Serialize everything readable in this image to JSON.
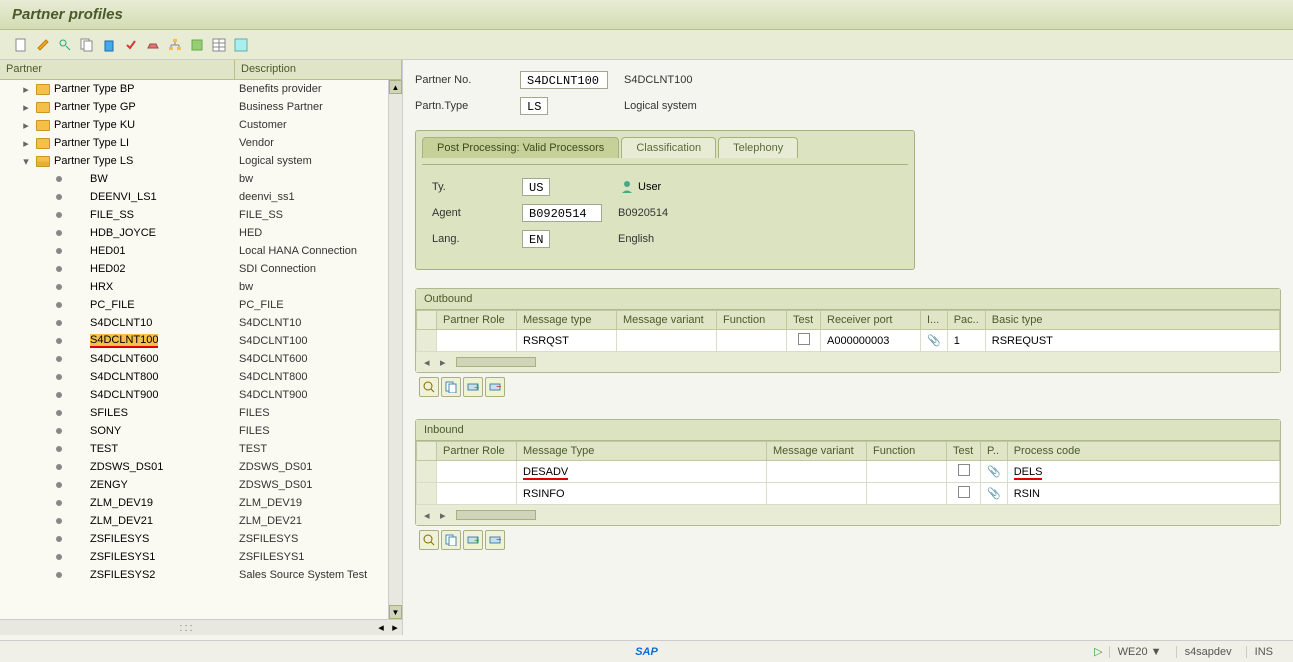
{
  "header": {
    "title": "Partner profiles"
  },
  "tree": {
    "col_partner": "Partner",
    "col_desc": "Description",
    "types": [
      {
        "label": "Partner Type BP",
        "desc": "Benefits provider",
        "expanded": false
      },
      {
        "label": "Partner Type GP",
        "desc": "Business Partner",
        "expanded": false
      },
      {
        "label": "Partner Type KU",
        "desc": "Customer",
        "expanded": false
      },
      {
        "label": "Partner Type LI",
        "desc": "Vendor",
        "expanded": false
      },
      {
        "label": "Partner Type LS",
        "desc": "Logical system",
        "expanded": true
      }
    ],
    "ls_items": [
      {
        "name": "BW",
        "desc": "bw"
      },
      {
        "name": "DEENVI_LS1",
        "desc": "deenvi_ss1"
      },
      {
        "name": "FILE_SS",
        "desc": "FILE_SS"
      },
      {
        "name": "HDB_JOYCE",
        "desc": "HED"
      },
      {
        "name": "HED01",
        "desc": "Local HANA Connection"
      },
      {
        "name": "HED02",
        "desc": "SDI Connection"
      },
      {
        "name": "HRX",
        "desc": "bw"
      },
      {
        "name": "PC_FILE",
        "desc": "PC_FILE"
      },
      {
        "name": "S4DCLNT10",
        "desc": "S4DCLNT10"
      },
      {
        "name": "S4DCLNT100",
        "desc": "S4DCLNT100",
        "selected": true
      },
      {
        "name": "S4DCLNT600",
        "desc": "S4DCLNT600"
      },
      {
        "name": "S4DCLNT800",
        "desc": "S4DCLNT800"
      },
      {
        "name": "S4DCLNT900",
        "desc": "S4DCLNT900"
      },
      {
        "name": "SFILES",
        "desc": "FILES"
      },
      {
        "name": "SONY",
        "desc": "FILES"
      },
      {
        "name": "TEST",
        "desc": "TEST"
      },
      {
        "name": "ZDSWS_DS01",
        "desc": "ZDSWS_DS01"
      },
      {
        "name": "ZENGY",
        "desc": "ZDSWS_DS01"
      },
      {
        "name": "ZLM_DEV19",
        "desc": "ZLM_DEV19"
      },
      {
        "name": "ZLM_DEV21",
        "desc": "ZLM_DEV21"
      },
      {
        "name": "ZSFILESYS",
        "desc": "ZSFILESYS"
      },
      {
        "name": "ZSFILESYS1",
        "desc": "ZSFILESYS1"
      },
      {
        "name": "ZSFILESYS2",
        "desc": "Sales Source System Test"
      }
    ]
  },
  "detail": {
    "partner_no_label": "Partner No.",
    "partner_no_value": "S4DCLNT100",
    "partner_no_display": "S4DCLNT100",
    "partn_type_label": "Partn.Type",
    "partn_type_value": "LS",
    "partn_type_display": "Logical system"
  },
  "tabs": {
    "t1": "Post Processing: Valid Processors",
    "t2": "Classification",
    "t3": "Telephony",
    "ty_label": "Ty.",
    "ty_value": "US",
    "ty_display": "User",
    "agent_label": "Agent",
    "agent_value": "B0920514",
    "agent_display": "B0920514",
    "lang_label": "Lang.",
    "lang_value": "EN",
    "lang_display": "English"
  },
  "outbound": {
    "title": "Outbound",
    "cols": {
      "role": "Partner Role",
      "msgtype": "Message type",
      "variant": "Message variant",
      "func": "Function",
      "test": "Test",
      "port": "Receiver port",
      "i": "I...",
      "pac": "Pac..",
      "basic": "Basic type"
    },
    "rows": [
      {
        "role": "",
        "msgtype": "RSRQST",
        "variant": "",
        "func": "",
        "test": false,
        "port": "A000000003",
        "i": "📎",
        "pac": "1",
        "basic": "RSREQUST"
      }
    ]
  },
  "inbound": {
    "title": "Inbound",
    "cols": {
      "role": "Partner Role",
      "msgtype": "Message Type",
      "variant": "Message variant",
      "func": "Function",
      "test": "Test",
      "p": "P..",
      "proc": "Process code"
    },
    "rows": [
      {
        "role": "",
        "msgtype": "DESADV",
        "variant": "",
        "func": "",
        "test": false,
        "p": "📎",
        "proc": "DELS",
        "hl": true
      },
      {
        "role": "",
        "msgtype": "RSINFO",
        "variant": "",
        "func": "",
        "test": false,
        "p": "📎",
        "proc": "RSIN"
      }
    ]
  },
  "status": {
    "sap": "SAP",
    "tcode": "WE20",
    "system": "s4sapdev",
    "mode": "INS"
  }
}
